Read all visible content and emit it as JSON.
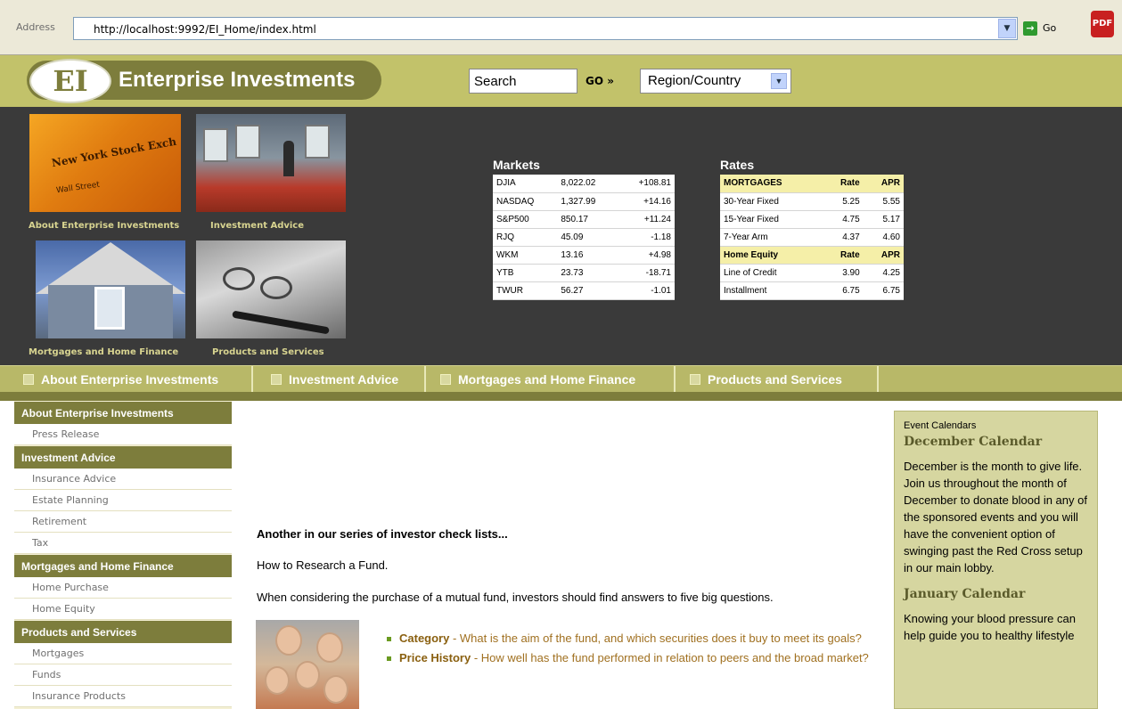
{
  "browser": {
    "address_label": "Address",
    "url": "http://localhost:9992/EI_Home/index.html",
    "go_label": "Go"
  },
  "header": {
    "logo_initials": "EI",
    "logo_text": "Enterprise Investments",
    "search_value": "Search",
    "go_label": "GO »",
    "region_value": "Region/Country"
  },
  "tiles": [
    {
      "caption": "About Enterprise Investments"
    },
    {
      "caption": "Investment Advice"
    },
    {
      "caption": "Mortgages and Home Finance"
    },
    {
      "caption": "Products and Services"
    }
  ],
  "markets": {
    "title": "Markets",
    "rows": [
      {
        "symbol": "DJIA",
        "value": "8,022.02",
        "change": "+108.81"
      },
      {
        "symbol": "NASDAQ",
        "value": "1,327.99",
        "change": "+14.16"
      },
      {
        "symbol": "S&P500",
        "value": "850.17",
        "change": "+11.24"
      },
      {
        "symbol": "RJQ",
        "value": "45.09",
        "change": "-1.18"
      },
      {
        "symbol": "WKM",
        "value": "13.16",
        "change": "+4.98"
      },
      {
        "symbol": "YTB",
        "value": "23.73",
        "change": "-18.71"
      },
      {
        "symbol": "TWUR",
        "value": "56.27",
        "change": "-1.01"
      }
    ]
  },
  "rates": {
    "title": "Rates",
    "rows": [
      {
        "label": "MORTGAGES",
        "rate": "Rate",
        "apr": "APR",
        "header": true
      },
      {
        "label": "30-Year Fixed",
        "rate": "5.25",
        "apr": "5.55"
      },
      {
        "label": "15-Year Fixed",
        "rate": "4.75",
        "apr": "5.17"
      },
      {
        "label": "7-Year Arm",
        "rate": "4.37",
        "apr": "4.60"
      },
      {
        "label": "Home Equity",
        "rate": "Rate",
        "apr": "APR",
        "header": true
      },
      {
        "label": "Line of Credit",
        "rate": "3.90",
        "apr": "4.25"
      },
      {
        "label": "Installment",
        "rate": "6.75",
        "apr": "6.75"
      }
    ]
  },
  "nav": [
    {
      "label": "About Enterprise Investments"
    },
    {
      "label": "Investment Advice"
    },
    {
      "label": "Mortgages and Home Finance"
    },
    {
      "label": "Products and Services"
    }
  ],
  "sidebar": {
    "sections": [
      {
        "title": "About Enterprise Investments",
        "items": [
          "Press Release"
        ]
      },
      {
        "title": "Investment Advice",
        "items": [
          "Insurance Advice",
          "Estate Planning",
          "Retirement",
          "Tax"
        ]
      },
      {
        "title": "Mortgages and Home Finance",
        "items": [
          "Home Purchase",
          "Home Equity"
        ]
      },
      {
        "title": "Products and Services",
        "items": [
          "Mortgages",
          "Funds",
          "Insurance Products"
        ]
      }
    ]
  },
  "main": {
    "heading": "Another in our series of investor check lists...",
    "subheading": "How to Research a Fund.",
    "intro": "When considering the purchase of a mutual fund, investors should find answers to five big questions.",
    "bullets": [
      {
        "title": "Category",
        "text": " -   What is the aim of the fund, and which securities does it buy to meet its goals?"
      },
      {
        "title": "Price History",
        "text": " - How well has the fund performed in relation to peers and the broad market?"
      }
    ]
  },
  "events": {
    "label": "Event Calendars",
    "items": [
      {
        "title": "December Calendar",
        "text": "December is the month to give life.  Join us throughout the month of December to donate blood in any of the sponsored events and you will have the convenient option of swinging past the Red Cross setup in our main lobby."
      },
      {
        "title": "January Calendar",
        "text": "Knowing your blood pressure can help guide you to healthy lifestyle"
      }
    ]
  }
}
